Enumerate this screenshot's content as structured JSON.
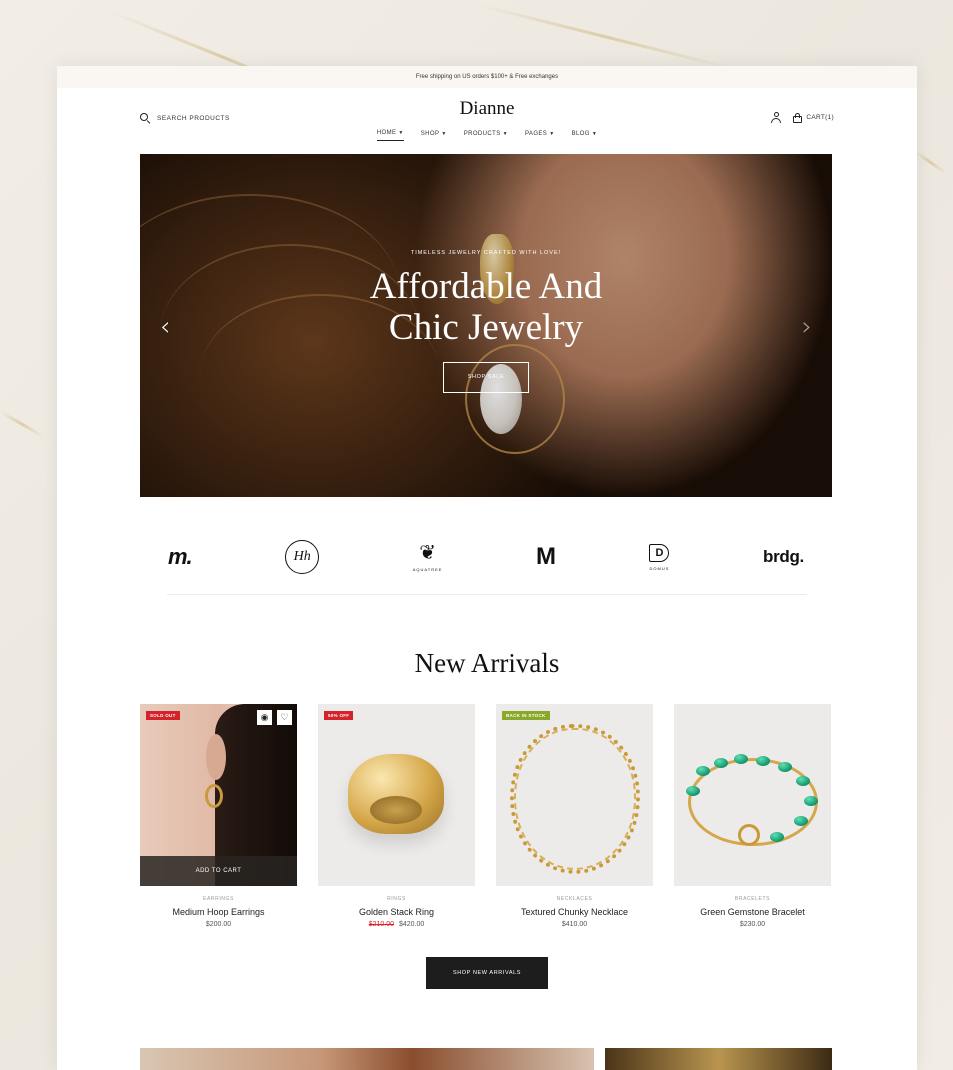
{
  "announcement": "Free shipping on US orders $100+ & Free exchanges",
  "header": {
    "search_label": "SEARCH PRODUCTS",
    "logo": "Dianne",
    "nav": [
      {
        "label": "HOME",
        "active": true
      },
      {
        "label": "SHOP",
        "active": false
      },
      {
        "label": "PRODUCTS",
        "active": false
      },
      {
        "label": "PAGES",
        "active": false
      },
      {
        "label": "BLOG",
        "active": false
      }
    ],
    "cart_label": "CART(1)"
  },
  "hero": {
    "eyebrow": "TIMELESS JEWELRY CRAFTED WITH LOVE!",
    "title_line1": "Affordable And",
    "title_line2": "Chic Jewelry",
    "button": "SHOP SALE"
  },
  "brands": [
    {
      "text": "m.",
      "small": ""
    },
    {
      "text": "Hh",
      "small": ""
    },
    {
      "text": "❦",
      "small": "AQUATREE"
    },
    {
      "text": "M",
      "small": ""
    },
    {
      "text": "D",
      "small": "DOMUS"
    },
    {
      "text": "brdg.",
      "small": ""
    }
  ],
  "new_arrivals": {
    "title": "New Arrivals",
    "products": [
      {
        "badge": "SOLD OUT",
        "category": "EARRINGS",
        "name": "Medium Hoop Earrings",
        "old_price": "",
        "price": "$200.00",
        "add_to_cart": "ADD TO CART"
      },
      {
        "badge": "50% OFF",
        "category": "RINGS",
        "name": "Golden Stack Ring",
        "old_price": "$210.00",
        "price": "$420.00"
      },
      {
        "badge": "BACK IN STOCK",
        "category": "NECKLACES",
        "name": "Textured Chunky Necklace",
        "old_price": "",
        "price": "$410.00"
      },
      {
        "badge": "",
        "category": "BRACELETS",
        "name": "Green Gemstone Bracelet",
        "old_price": "",
        "price": "$230.00"
      }
    ],
    "button": "SHOP NEW ARRIVALS"
  },
  "icons": {
    "quick_view": "eye-icon",
    "wishlist": "heart-icon",
    "prev": "chevron-left-icon",
    "next": "chevron-right-icon"
  },
  "colors": {
    "sale_red": "#d4232a",
    "stock_green": "#8aa82a",
    "button_dark": "#1d1d1d"
  }
}
